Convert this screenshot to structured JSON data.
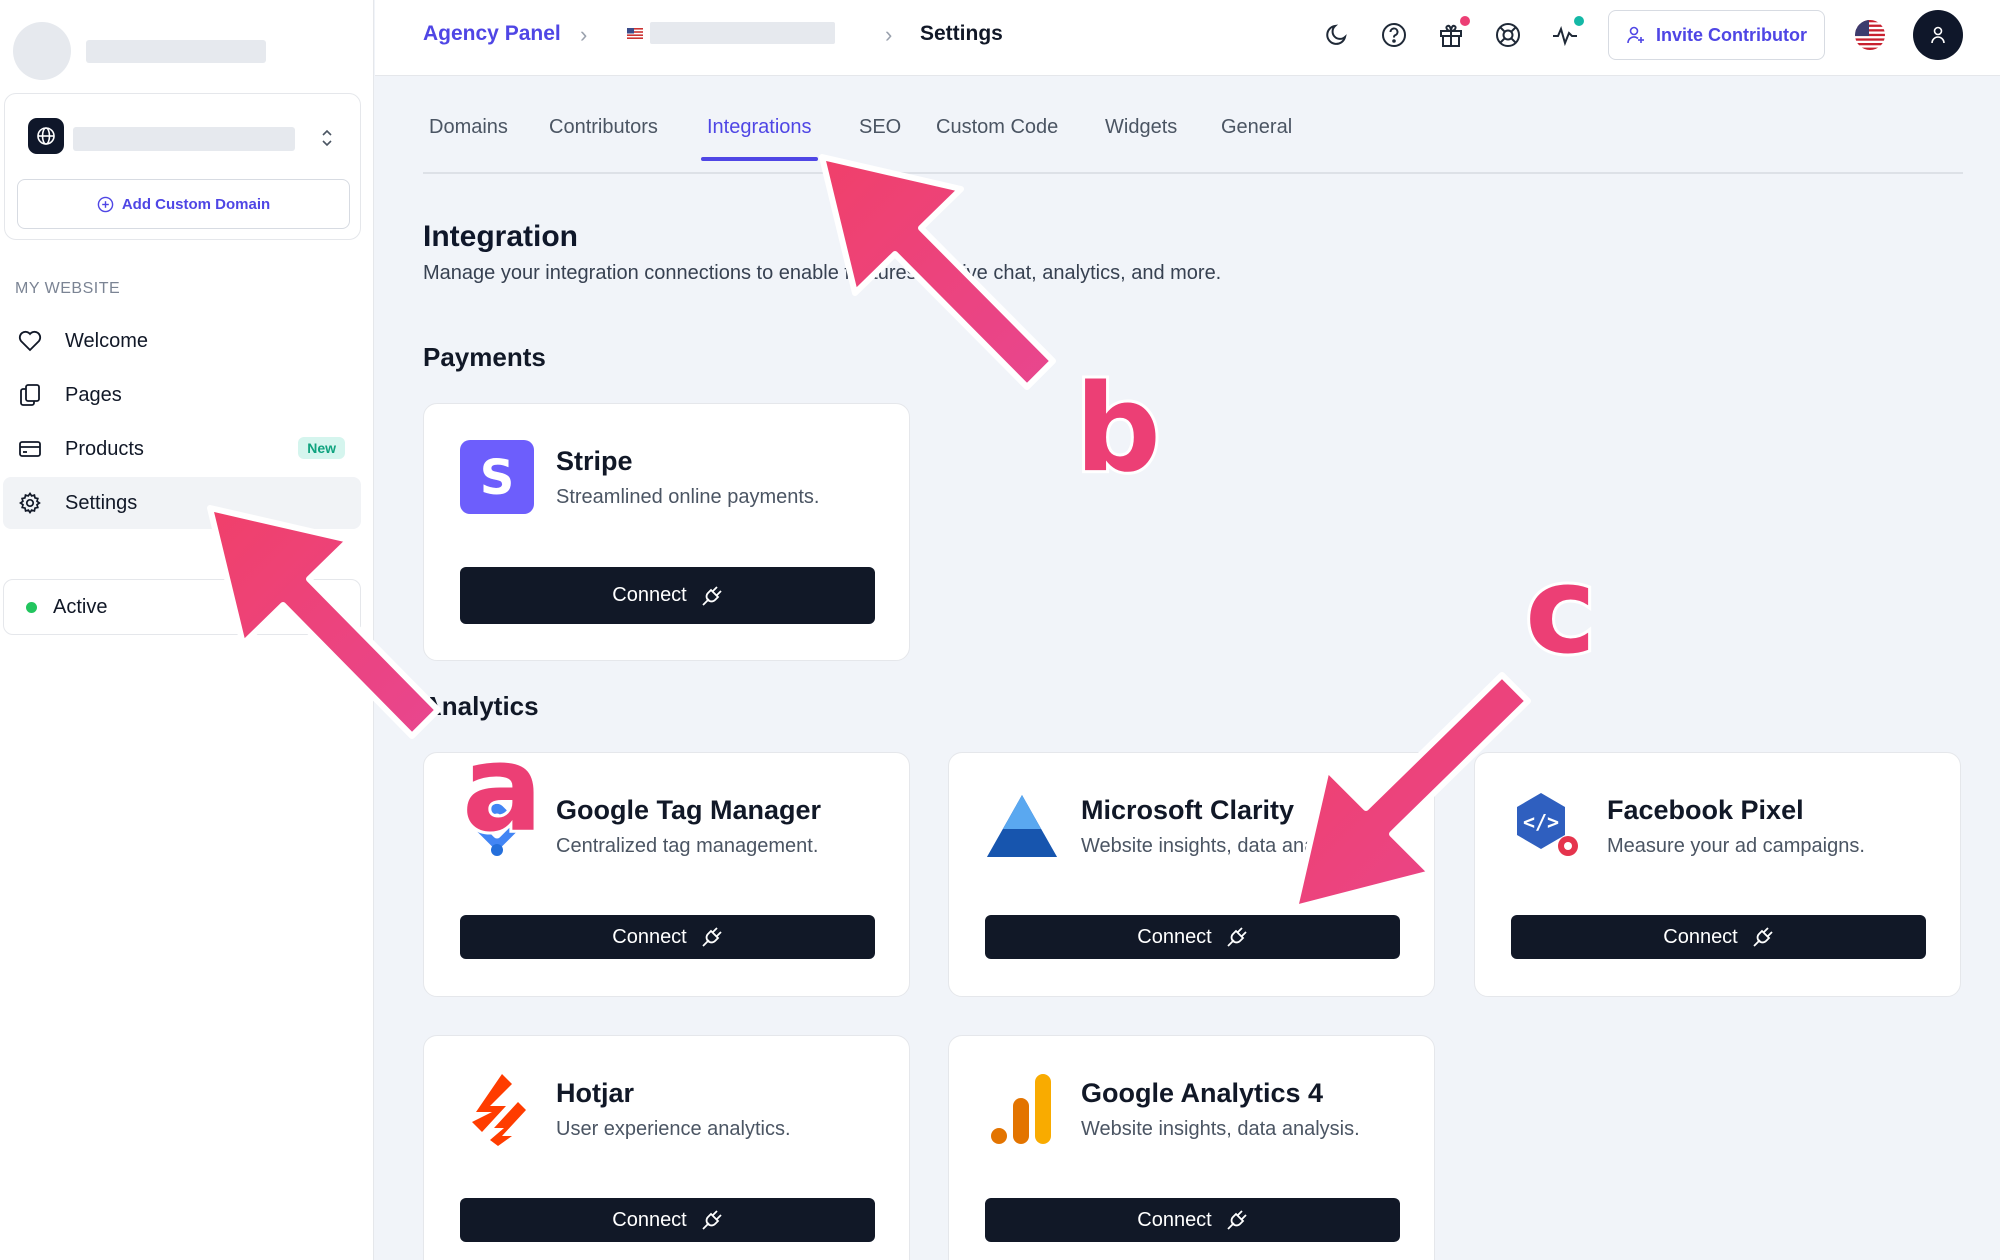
{
  "sidebar": {
    "add_domain_label": "Add Custom Domain",
    "section_label": "MY WEBSITE",
    "items": [
      {
        "label": "Welcome",
        "icon": "heart-icon"
      },
      {
        "label": "Pages",
        "icon": "pages-icon"
      },
      {
        "label": "Products",
        "icon": "card-icon",
        "badge": "New"
      },
      {
        "label": "Settings",
        "icon": "gear-icon"
      }
    ],
    "status_label": "Active"
  },
  "header": {
    "breadcrumb_root": "Agency Panel",
    "breadcrumb_current": "Settings",
    "invite_label": "Invite Contributor",
    "icons": [
      "moon-icon",
      "help-icon",
      "gift-icon",
      "support-icon",
      "activity-icon"
    ]
  },
  "tabs": [
    {
      "label": "Domains"
    },
    {
      "label": "Contributors"
    },
    {
      "label": "Integrations",
      "active": true
    },
    {
      "label": "SEO"
    },
    {
      "label": "Custom Code"
    },
    {
      "label": "Widgets"
    },
    {
      "label": "General"
    }
  ],
  "page": {
    "title": "Integration",
    "description": "Manage your integration connections to enable features like live chat, analytics, and more."
  },
  "sections": {
    "payments": "Payments",
    "analytics": "Analytics"
  },
  "integrations": {
    "stripe": {
      "name": "Stripe",
      "desc": "Streamlined online payments.",
      "button": "Connect"
    },
    "gtm": {
      "name": "Google Tag Manager",
      "desc": "Centralized tag management.",
      "button": "Connect"
    },
    "clarity": {
      "name": "Microsoft Clarity",
      "desc": "Website insights, data analysis.",
      "button": "Connect"
    },
    "fbpixel": {
      "name": "Facebook Pixel",
      "desc": "Measure your ad campaigns.",
      "button": "Connect"
    },
    "hotjar": {
      "name": "Hotjar",
      "desc": "User experience analytics.",
      "button": "Connect"
    },
    "ga4": {
      "name": "Google Analytics 4",
      "desc": "Website insights, data analysis.",
      "button": "Connect"
    }
  },
  "annotations": {
    "a": "a",
    "b": "b",
    "c": "c"
  },
  "colors": {
    "accent": "#4f46e5",
    "button_dark": "#111827",
    "annotation": "#ec3f75",
    "status_active": "#22c55e"
  }
}
